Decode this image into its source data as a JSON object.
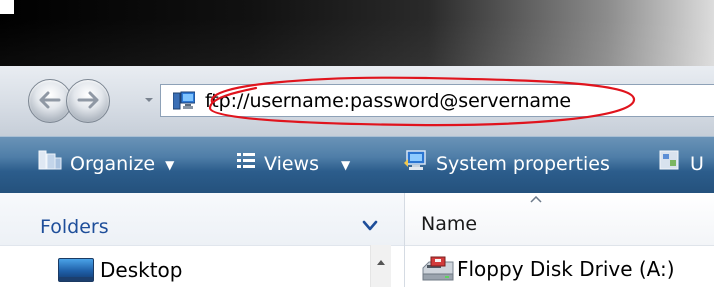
{
  "address_bar": {
    "value": "ftp://username:password@servername"
  },
  "toolbar": {
    "organize_label": "Organize",
    "views_label": "Views",
    "system_properties_label": "System properties",
    "cutoff_label": "U"
  },
  "folders_pane": {
    "title": "Folders",
    "items": [
      {
        "label": "Desktop",
        "icon": "desktop-icon"
      }
    ]
  },
  "files_pane": {
    "column_header": "Name",
    "rows": [
      {
        "label": "Floppy Disk Drive (A:)",
        "icon": "floppy-drive-icon"
      }
    ]
  },
  "colors": {
    "annotation_circle": "#e0141d",
    "toolbar_blue": "#2c5d8c",
    "folders_title": "#1e4e9a"
  }
}
